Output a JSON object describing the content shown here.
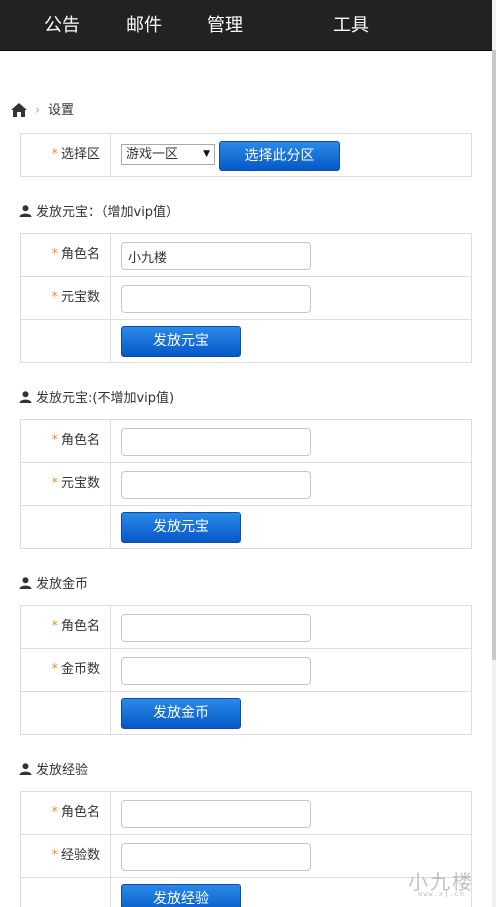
{
  "nav": {
    "items": [
      {
        "label": "公告"
      },
      {
        "label": "邮件"
      },
      {
        "label": "管理"
      },
      {
        "label": "工具"
      }
    ]
  },
  "breadcrumb": {
    "current": "设置"
  },
  "region": {
    "label": "选择区",
    "selected": "游戏一区",
    "button": "选择此分区"
  },
  "sections": [
    {
      "title": "发放元宝：（增加vip值）",
      "fields": [
        {
          "label": "角色名",
          "value": "小九楼"
        },
        {
          "label": "元宝数",
          "value": ""
        }
      ],
      "button": "发放元宝"
    },
    {
      "title": "发放元宝:(不增加vip值)",
      "fields": [
        {
          "label": "角色名",
          "value": ""
        },
        {
          "label": "元宝数",
          "value": ""
        }
      ],
      "button": "发放元宝"
    },
    {
      "title": "发放金币",
      "fields": [
        {
          "label": "角色名",
          "value": ""
        },
        {
          "label": "金币数",
          "value": ""
        }
      ],
      "button": "发放金币"
    },
    {
      "title": "发放经验",
      "fields": [
        {
          "label": "角色名",
          "value": ""
        },
        {
          "label": "经验数",
          "value": ""
        }
      ],
      "button": "发放经验"
    }
  ],
  "required_mark": "*",
  "watermark": {
    "main": "小九楼",
    "sub": "www.xj.cn"
  },
  "colors": {
    "navbar": "#222222",
    "button": "#0658c8",
    "required": "#e8912e",
    "border": "#dddddd"
  }
}
